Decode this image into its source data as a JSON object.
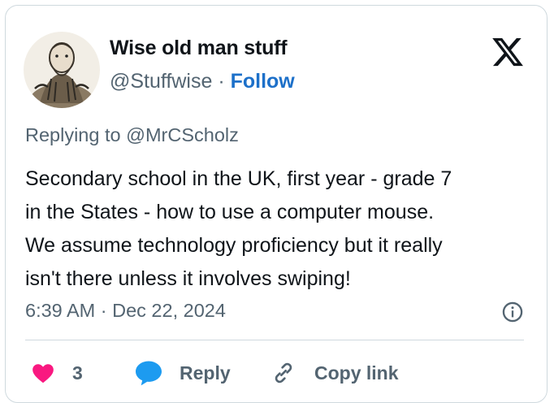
{
  "author": {
    "name": "Wise old man stuff",
    "handle": "@Stuffwise",
    "separator": "·",
    "follow_label": "Follow"
  },
  "reply_context": {
    "prefix": "Replying to",
    "user": "@MrCScholz"
  },
  "tweet": {
    "text": "Secondary school in the UK, first year - grade 7\nin the States - how to use a computer mouse.\nWe assume technology proficiency but it really\nisn't there unless it involves swiping!",
    "timestamp": "6:39 AM · Dec 22, 2024"
  },
  "actions": {
    "like_count": "3",
    "reply_label": "Reply",
    "copy_link_label": "Copy link"
  },
  "colors": {
    "like": "#f91880",
    "reply": "#1d9bf0",
    "follow": "#1d70c9",
    "secondary_text": "#536471",
    "border": "#cfd9de"
  },
  "icons": [
    "x-logo-icon",
    "info-icon",
    "heart-icon",
    "reply-bubble-icon",
    "link-icon"
  ]
}
